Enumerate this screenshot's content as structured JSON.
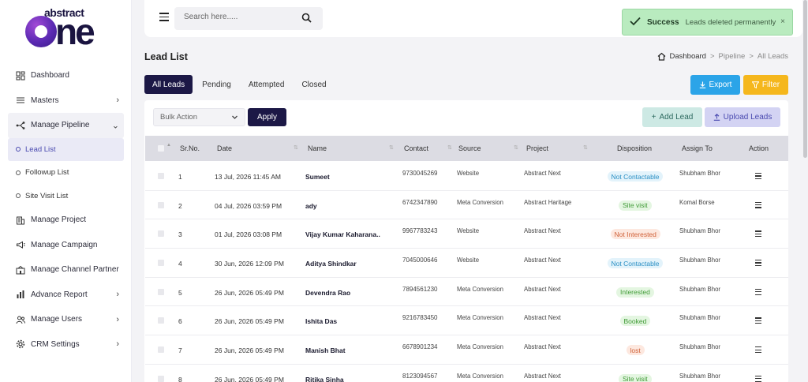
{
  "brand": {
    "top": "abstract",
    "main": "ne"
  },
  "header": {
    "search_placeholder": "Search here....."
  },
  "toast": {
    "title": "Success",
    "message": "Leads deleted permanently",
    "close": "×",
    "color": "#b9ebbf"
  },
  "sidebar": {
    "items": [
      {
        "label": "Dashboard",
        "icon": "dashboard-icon"
      },
      {
        "label": "Masters",
        "icon": "list-icon",
        "chevron": "›"
      },
      {
        "label": "Manage Pipeline",
        "icon": "pipeline-icon",
        "chevron": "⌄"
      },
      {
        "label": "Manage Project",
        "icon": "building-icon"
      },
      {
        "label": "Manage Campaign",
        "icon": "megaphone-icon"
      },
      {
        "label": "Manage Channel Partner",
        "icon": "partner-icon"
      },
      {
        "label": "Advance Report",
        "icon": "chart-icon",
        "chevron": "›"
      },
      {
        "label": "Manage Users",
        "icon": "users-icon",
        "chevron": "›"
      },
      {
        "label": "CRM Settings",
        "icon": "gear-icon",
        "chevron": "›"
      }
    ],
    "sub_items": [
      {
        "label": "Lead List"
      },
      {
        "label": "Followup List"
      },
      {
        "label": "Site Visit List"
      }
    ]
  },
  "page": {
    "title": "Lead List",
    "breadcrumb": [
      "Dashboard",
      "Pipeline",
      "All Leads"
    ],
    "breadcrumb_sep": ">"
  },
  "tabs": [
    "All Leads",
    "Pending",
    "Attempted",
    "Closed"
  ],
  "actions": {
    "export": "Export",
    "filter": "Filter",
    "bulk_action": "Bulk Action",
    "apply": "Apply",
    "add_lead": "Add Lead",
    "upload_leads": "Upload Leads"
  },
  "table": {
    "headers": [
      "Sr.No.",
      "Date",
      "Name",
      "Contact",
      "Source",
      "Project",
      "Disposition",
      "Assign To",
      "Action"
    ],
    "rows": [
      {
        "sr": "1",
        "date": "13 Jul, 2026 11:45 AM",
        "name": "Sumeet",
        "contact": "9730045269",
        "source": "Website",
        "project": "Abstract Next",
        "disposition": "Not Contactable",
        "assign": "Shubham Bhor"
      },
      {
        "sr": "2",
        "date": "04 Jul, 2026 03:59 PM",
        "name": "ady",
        "contact": "6742347890",
        "source": "Meta Conversion",
        "project": "Abstract Haritage",
        "disposition": "Site visit",
        "assign": "Komal Borse"
      },
      {
        "sr": "3",
        "date": "01 Jul, 2026 03:08 PM",
        "name": "Vijay Kumar Kaharana..",
        "contact": "9967783243",
        "source": "Website",
        "project": "Abstract Next",
        "disposition": "Not Interested",
        "assign": "Shubham Bhor"
      },
      {
        "sr": "4",
        "date": "30 Jun, 2026 12:09 PM",
        "name": "Aditya Shindkar",
        "contact": "7045000646",
        "source": "Website",
        "project": "Abstract Next",
        "disposition": "Not Contactable",
        "assign": "Shubham Bhor"
      },
      {
        "sr": "5",
        "date": "26 Jun, 2026 05:49 PM",
        "name": "Devendra Rao",
        "contact": "7894561230",
        "source": "Meta Conversion",
        "project": "Abstract Next",
        "disposition": "Interested",
        "assign": "Shubham Bhor"
      },
      {
        "sr": "6",
        "date": "26 Jun, 2026 05:49 PM",
        "name": "Ishita Das",
        "contact": "9216783450",
        "source": "Meta Conversion",
        "project": "Abstract Next",
        "disposition": "Booked",
        "assign": "Shubham Bhor"
      },
      {
        "sr": "7",
        "date": "26 Jun, 2026 05:49 PM",
        "name": "Manish Bhat",
        "contact": "6678901234",
        "source": "Meta Conversion",
        "project": "Abstract Next",
        "disposition": "lost",
        "assign": "Shubham Bhor"
      },
      {
        "sr": "8",
        "date": "26 Jun, 2026 05:49 PM",
        "name": "Ritika Sinha",
        "contact": "8123094567",
        "source": "Meta Conversion",
        "project": "Abstract Next",
        "disposition": "Site visit",
        "assign": "Shubham Bhor"
      }
    ]
  },
  "disposition_colors": {
    "Not Contactable": {
      "bg": "#e3f3fb",
      "fg": "#2a8fc4"
    },
    "Site visit": {
      "bg": "#e4f6e1",
      "fg": "#3f9a35"
    },
    "Not Interested": {
      "bg": "#fde8df",
      "fg": "#d0623a"
    },
    "Interested": {
      "bg": "#e4f6e1",
      "fg": "#3f9a35"
    },
    "Booked": {
      "bg": "#e4f6e1",
      "fg": "#3f9a35"
    },
    "lost": {
      "bg": "#fde8df",
      "fg": "#d0623a"
    }
  },
  "colors": {
    "primary": "#1c1846",
    "export": "#2ba4e8",
    "filter": "#f5b71d",
    "add": "#cde9e4",
    "upload": "#d3d3f3"
  }
}
